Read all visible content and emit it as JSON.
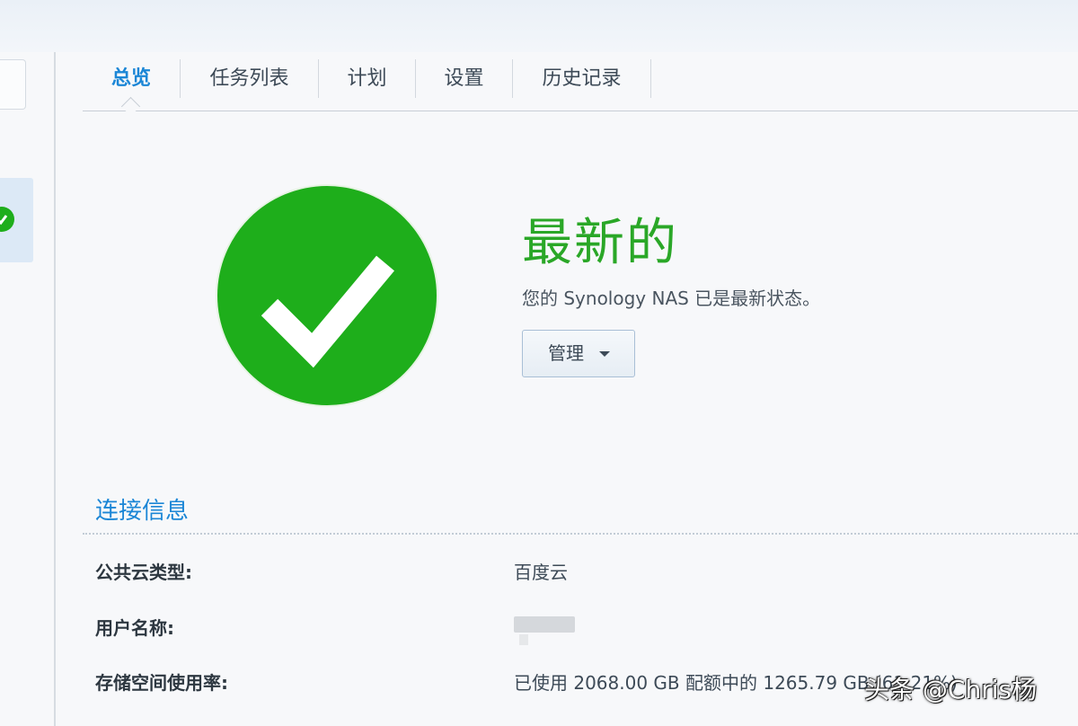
{
  "tabs": [
    {
      "label": "总览",
      "active": true
    },
    {
      "label": "任务列表"
    },
    {
      "label": "计划"
    },
    {
      "label": "设置"
    },
    {
      "label": "历史记录"
    }
  ],
  "status": {
    "icon": "check-circle-icon",
    "title": "最新的",
    "description": "您的 Synology NAS 已是最新状态。",
    "manage_label": "管理",
    "color": "#1eae1b"
  },
  "connection": {
    "title": "连接信息",
    "rows": [
      {
        "label": "公共云类型:",
        "value": "百度云"
      },
      {
        "label": "用户名称:",
        "value": ""
      },
      {
        "label": "存储空间使用率:",
        "value": "已使用 2068.00 GB 配额中的 1265.79 GB (61.21%)"
      }
    ]
  },
  "watermark": "头条 @Chris杨",
  "colors": {
    "accent": "#1b86d6",
    "success": "#1eae1b"
  }
}
